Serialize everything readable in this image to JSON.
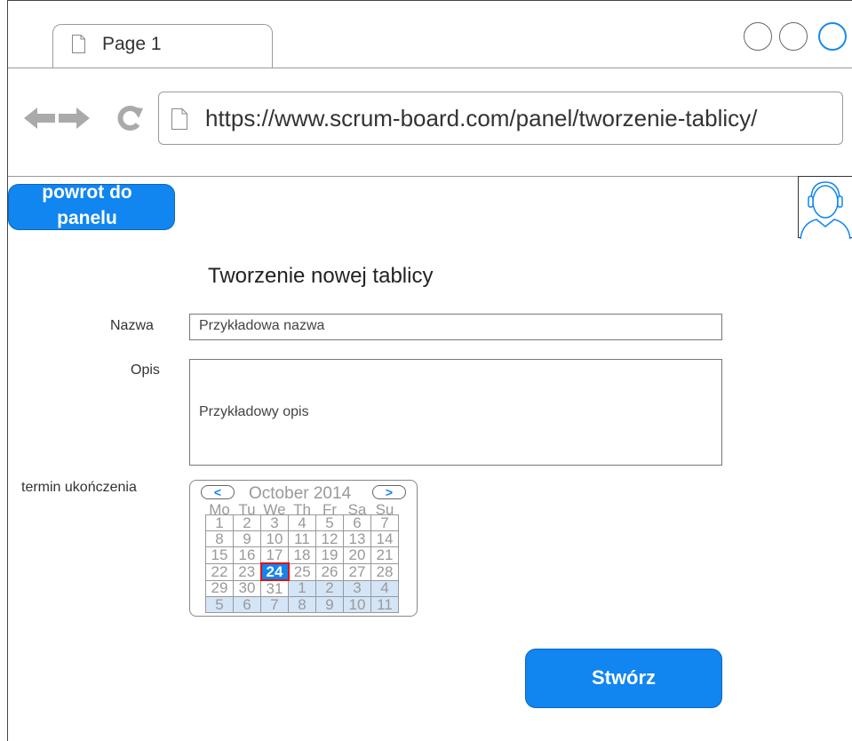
{
  "browser": {
    "tab_title": "Page 1",
    "url": "https://www.scrum-board.com/panel/tworzenie-tablicy/"
  },
  "header": {
    "back_button_label": "powrot do panelu",
    "avatar_icon": "user-avatar-icon"
  },
  "form": {
    "title": "Tworzenie nowej tablicy",
    "name_label": "Nazwa",
    "name_value": "Przykładowa nazwa",
    "description_label": "Opis",
    "description_value": "Przykładowy opis",
    "deadline_label": "termin ukończenia",
    "submit_label": "Stwórz"
  },
  "calendar": {
    "month_label": "October 2014",
    "prev_icon": "chevron-left-icon",
    "next_icon": "chevron-right-icon",
    "weekdays": [
      "Mo",
      "Tu",
      "We",
      "Th",
      "Fr",
      "Sa",
      "Su"
    ],
    "weeks": [
      [
        "1",
        "2",
        "3",
        "4",
        "5",
        "6",
        "7"
      ],
      [
        "8",
        "9",
        "10",
        "11",
        "12",
        "13",
        "14"
      ],
      [
        "15",
        "16",
        "17",
        "18",
        "19",
        "20",
        "21"
      ],
      [
        "22",
        "23",
        "24",
        "25",
        "26",
        "27",
        "28"
      ],
      [
        "29",
        "30",
        "31",
        "1",
        "2",
        "3",
        "4"
      ],
      [
        "5",
        "6",
        "7",
        "8",
        "9",
        "10",
        "11"
      ]
    ],
    "selected": "24"
  },
  "colors": {
    "accent": "#1185f0",
    "selected_border": "#e01010",
    "next_month_bg": "#d4e5f7"
  }
}
